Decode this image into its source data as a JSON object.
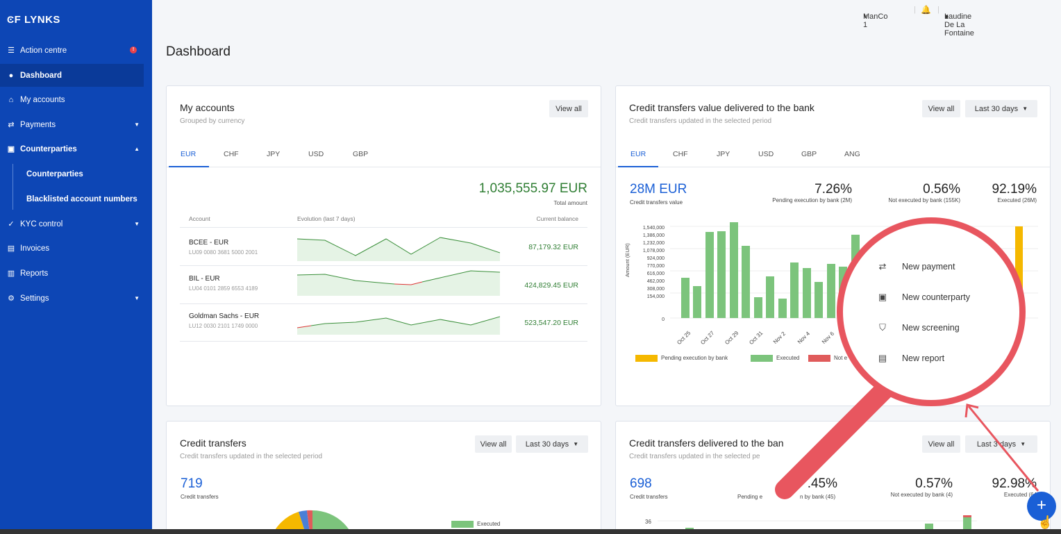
{
  "brand": {
    "logo": "LYNKS"
  },
  "sidebar": {
    "items": [
      {
        "label": "Action centre",
        "icon": "list-icon",
        "badge": "!"
      },
      {
        "label": "Dashboard",
        "icon": "dashboard-icon"
      },
      {
        "label": "My accounts",
        "icon": "bank-icon"
      },
      {
        "label": "Payments",
        "icon": "transfer-icon"
      },
      {
        "label": "Counterparties",
        "icon": "contact-card-icon"
      },
      {
        "label": "Counterparties"
      },
      {
        "label": "Blacklisted account numbers"
      },
      {
        "label": "KYC control",
        "icon": "shield-check-icon"
      },
      {
        "label": "Invoices",
        "icon": "invoice-icon"
      },
      {
        "label": "Reports",
        "icon": "report-icon"
      },
      {
        "label": "Settings",
        "icon": "gear-icon"
      }
    ]
  },
  "topbar": {
    "company": "ManCo 1",
    "user": "Laudine De La Fontaine"
  },
  "page": {
    "title": "Dashboard"
  },
  "accounts_card": {
    "title": "My accounts",
    "subtitle": "Grouped by currency",
    "view_all": "View all",
    "tabs": [
      "EUR",
      "CHF",
      "JPY",
      "USD",
      "GBP"
    ],
    "total": "1,035,555.97 EUR",
    "total_label": "Total amount",
    "columns": [
      "Account",
      "Evolution (last 7 days)",
      "Current balance"
    ],
    "rows": [
      {
        "name": "BCEE - EUR",
        "iban": "LU09 0080 3681 5000 2001",
        "balance": "87,179.32 EUR"
      },
      {
        "name": "BIL - EUR",
        "iban": "LU04 0101 2859 6553 4189",
        "balance": "424,829.45 EUR"
      },
      {
        "name": "Goldman Sachs - EUR",
        "iban": "LU12 0030 2101 1749 0000",
        "balance": "523,547.20 EUR"
      }
    ]
  },
  "value_card": {
    "title": "Credit transfers value delivered to the bank",
    "subtitle": "Credit transfers updated in the selected period",
    "view_all": "View all",
    "period": "Last 30 days",
    "tabs": [
      "EUR",
      "CHF",
      "JPY",
      "USD",
      "GBP",
      "ANG"
    ],
    "main_value": "28M EUR",
    "main_label": "Credit transfers value",
    "stats": [
      {
        "value": "7.26%",
        "label": "Pending execution by bank (2M)"
      },
      {
        "value": "0.56%",
        "label": "Not executed by bank (155K)"
      },
      {
        "value": "92.19%",
        "label": "Executed (26M)"
      }
    ],
    "ylabel": "Amount (EUR)",
    "yticks": [
      "1,540,000",
      "1,386,000",
      "1,232,000",
      "1,078,000",
      "924,000",
      "770,000",
      "616,000",
      "462,000",
      "308,000",
      "154,000",
      "0"
    ],
    "xticks": [
      "Oct 25",
      "Oct 27",
      "Oct 29",
      "Oct 31",
      "Nov 2",
      "Nov 4",
      "Nov 6"
    ],
    "legend": [
      "Pending execution by bank",
      "Executed",
      "Not e"
    ]
  },
  "transfers_card": {
    "title": "Credit transfers",
    "subtitle": "Credit transfers updated in the selected period",
    "view_all": "View all",
    "period": "Last 30 days",
    "count": "719",
    "count_label": "Credit transfers",
    "legend": "Executed"
  },
  "delivered_card": {
    "title": "Credit transfers delivered to the ban",
    "subtitle": "Credit transfers updated in the selected pe",
    "view_all": "View all",
    "period": "Last 3",
    "period_rest": "days",
    "count": "698",
    "count_label": "Credit transfers",
    "stats": [
      {
        "value": ".45%",
        "label_a": "Pending e",
        "label_b": "n by bank (45)"
      },
      {
        "value": "0.57%",
        "label": "Not executed by bank (4)"
      },
      {
        "value": "92.98%",
        "label": "Executed (64"
      }
    ],
    "ytick": "36"
  },
  "quick_menu": {
    "items": [
      {
        "label": "New payment",
        "icon": "transfer-icon"
      },
      {
        "label": "New counterparty",
        "icon": "contact-card-icon"
      },
      {
        "label": "New screening",
        "icon": "shield-check-icon"
      },
      {
        "label": "New report",
        "icon": "document-icon"
      }
    ]
  },
  "fab": {
    "label": "+"
  },
  "colors": {
    "sidebar": "#0d46b5",
    "accent": "#1a5fd6",
    "executed": "#7cc47c",
    "pending": "#f5b800",
    "not_executed": "#e05b5b",
    "magnifier": "#e8565f"
  }
}
